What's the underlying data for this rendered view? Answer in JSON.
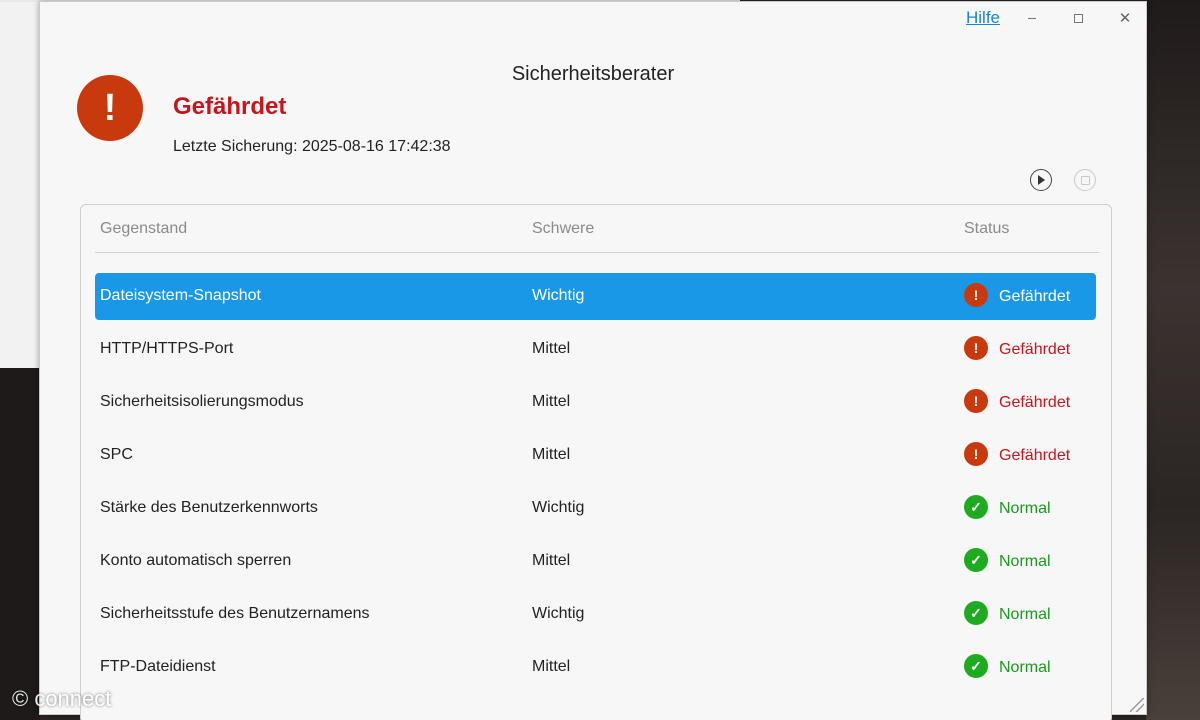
{
  "window": {
    "title": "Sicherheitsberater",
    "help_label": "Hilfe",
    "close_glyph": "✕"
  },
  "summary": {
    "alert_glyph": "!",
    "status": "Gefährdet",
    "last_backup_label": "Letzte Sicherung:",
    "last_backup_value": "2025-08-16 17:42:38"
  },
  "table": {
    "headers": {
      "item": "Gegenstand",
      "severity": "Schwere",
      "status": "Status"
    },
    "rows": [
      {
        "item": "Dateisystem-Snapshot",
        "severity": "Wichtig",
        "status": "Gefährdet",
        "state": "warn",
        "glyph": "!"
      },
      {
        "item": "HTTP/HTTPS-Port",
        "severity": "Mittel",
        "status": "Gefährdet",
        "state": "warn",
        "glyph": "!"
      },
      {
        "item": "Sicherheitsisolierungsmodus",
        "severity": "Mittel",
        "status": "Gefährdet",
        "state": "warn",
        "glyph": "!"
      },
      {
        "item": "SPC",
        "severity": "Mittel",
        "status": "Gefährdet",
        "state": "warn",
        "glyph": "!"
      },
      {
        "item": "Stärke des Benutzerkennworts",
        "severity": "Wichtig",
        "status": "Normal",
        "state": "ok",
        "glyph": "✓"
      },
      {
        "item": "Konto automatisch sperren",
        "severity": "Mittel",
        "status": "Normal",
        "state": "ok",
        "glyph": "✓"
      },
      {
        "item": "Sicherheitsstufe des Benutzernamens",
        "severity": "Wichtig",
        "status": "Normal",
        "state": "ok",
        "glyph": "✓"
      },
      {
        "item": "FTP-Dateidienst",
        "severity": "Mittel",
        "status": "Normal",
        "state": "ok",
        "glyph": "✓"
      }
    ],
    "selected_row": 0
  },
  "colors": {
    "danger": "#c4161c",
    "ok": "#1a9a1c",
    "selection": "#1a98e8",
    "link": "#1a87c9"
  },
  "watermark": "© connect"
}
